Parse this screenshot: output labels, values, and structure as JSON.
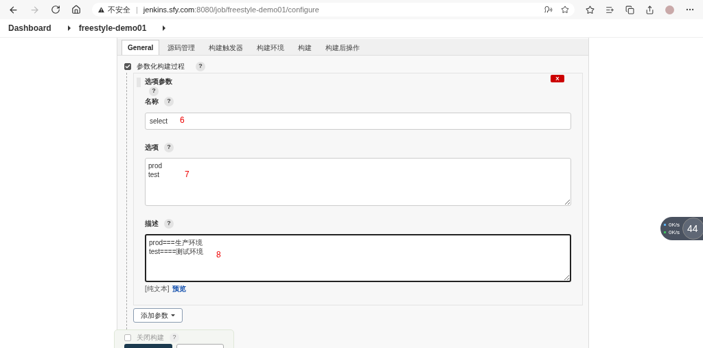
{
  "browser": {
    "security": "不安全",
    "separator": "|",
    "host": "jenkins.sfy.com",
    "path": ":8080/job/freestyle-demo01/configure"
  },
  "breadcrumbs": [
    {
      "label": "Dashboard"
    },
    {
      "label": "freestyle-demo01"
    }
  ],
  "tabs": [
    {
      "label": "General",
      "selected": true
    },
    {
      "label": "源码管理",
      "selected": false
    },
    {
      "label": "构建触发器",
      "selected": false
    },
    {
      "label": "构建环境",
      "selected": false
    },
    {
      "label": "构建",
      "selected": false
    },
    {
      "label": "构建后操作",
      "selected": false
    }
  ],
  "parameterized": {
    "label": "参数化构建过程",
    "checked": true,
    "help": "?"
  },
  "parameter": {
    "title": "选项参数",
    "help": "?",
    "delete": "X",
    "fields": [
      {
        "kind": "input",
        "label": "名称",
        "help": "?",
        "value": "select",
        "annotation": "6",
        "focused": false
      },
      {
        "kind": "textarea",
        "label": "选项",
        "help": "?",
        "value": "prod\ntest",
        "annotation": "7",
        "focused": false
      },
      {
        "kind": "textarea",
        "label": "描述",
        "help": "?",
        "value": "prod===生产环境\ntest====测试环境",
        "annotation": "8",
        "focused": true
      }
    ],
    "format_note": "[纯文本]",
    "preview_link": "预览"
  },
  "add_parameter": {
    "label": "添加参数"
  },
  "disable_build": {
    "label": "关闭构建",
    "checked": false,
    "help": "?"
  },
  "network_widget": {
    "upload": "0K/s",
    "download": "0K/s",
    "score": "44"
  }
}
